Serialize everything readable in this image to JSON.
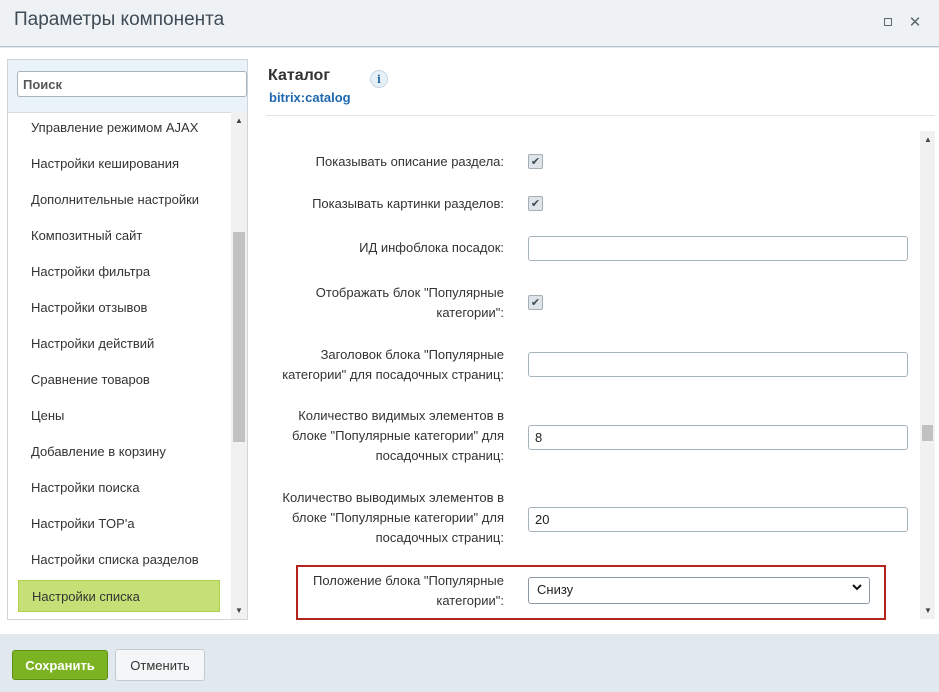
{
  "window": {
    "title": "Параметры компонента",
    "maximize_icon": "maximize-icon",
    "close_icon": "close-icon",
    "close_glyph": "✕"
  },
  "sidebar": {
    "search_placeholder": "Поиск",
    "search_value": "",
    "active_index": 13,
    "items": [
      {
        "label": "Управление режимом AJAX"
      },
      {
        "label": "Настройки кеширования"
      },
      {
        "label": "Дополнительные настройки"
      },
      {
        "label": "Композитный сайт"
      },
      {
        "label": "Настройки фильтра"
      },
      {
        "label": "Настройки отзывов"
      },
      {
        "label": "Настройки действий"
      },
      {
        "label": "Сравнение товаров"
      },
      {
        "label": "Цены"
      },
      {
        "label": "Добавление в корзину"
      },
      {
        "label": "Настройки поиска"
      },
      {
        "label": "Настройки TOP'а"
      },
      {
        "label": "Настройки списка разделов"
      },
      {
        "label": "Настройки списка"
      }
    ]
  },
  "main": {
    "title": "Каталог",
    "code": "bitrix:catalog",
    "info_glyph": "i",
    "fields": {
      "show_section_description": {
        "label": "Показывать описание раздела:",
        "checked": true
      },
      "show_section_pictures": {
        "label": "Показывать картинки разделов:",
        "checked": true
      },
      "landing_iblock_id": {
        "label": "ИД инфоблока посадок:",
        "value": ""
      },
      "show_popular_block": {
        "label_line1": "Отображать блок \"Популярные",
        "label_line2": "категории\":",
        "checked": true
      },
      "popular_block_title": {
        "label_line1": "Заголовок блока \"Популярные",
        "label_line2": "категории\" для посадочных страниц:",
        "value": ""
      },
      "visible_count": {
        "label_line1": "Количество видимых элементов в",
        "label_line2": "блоке \"Популярные категории\" для",
        "label_line3": "посадочных страниц:",
        "value": "8"
      },
      "output_count": {
        "label_line1": "Количество выводимых элементов в",
        "label_line2": "блоке \"Популярные категории\" для",
        "label_line3": "посадочных страниц:",
        "value": "20"
      },
      "block_position": {
        "label_line1": "Положение блока \"Популярные",
        "label_line2": "категории\":",
        "value": "Снизу"
      }
    },
    "check_glyph": "✔",
    "accent_highlight": "#b5231d"
  },
  "footer": {
    "save_label": "Сохранить",
    "cancel_label": "Отменить",
    "save_color": "#7cb323"
  }
}
